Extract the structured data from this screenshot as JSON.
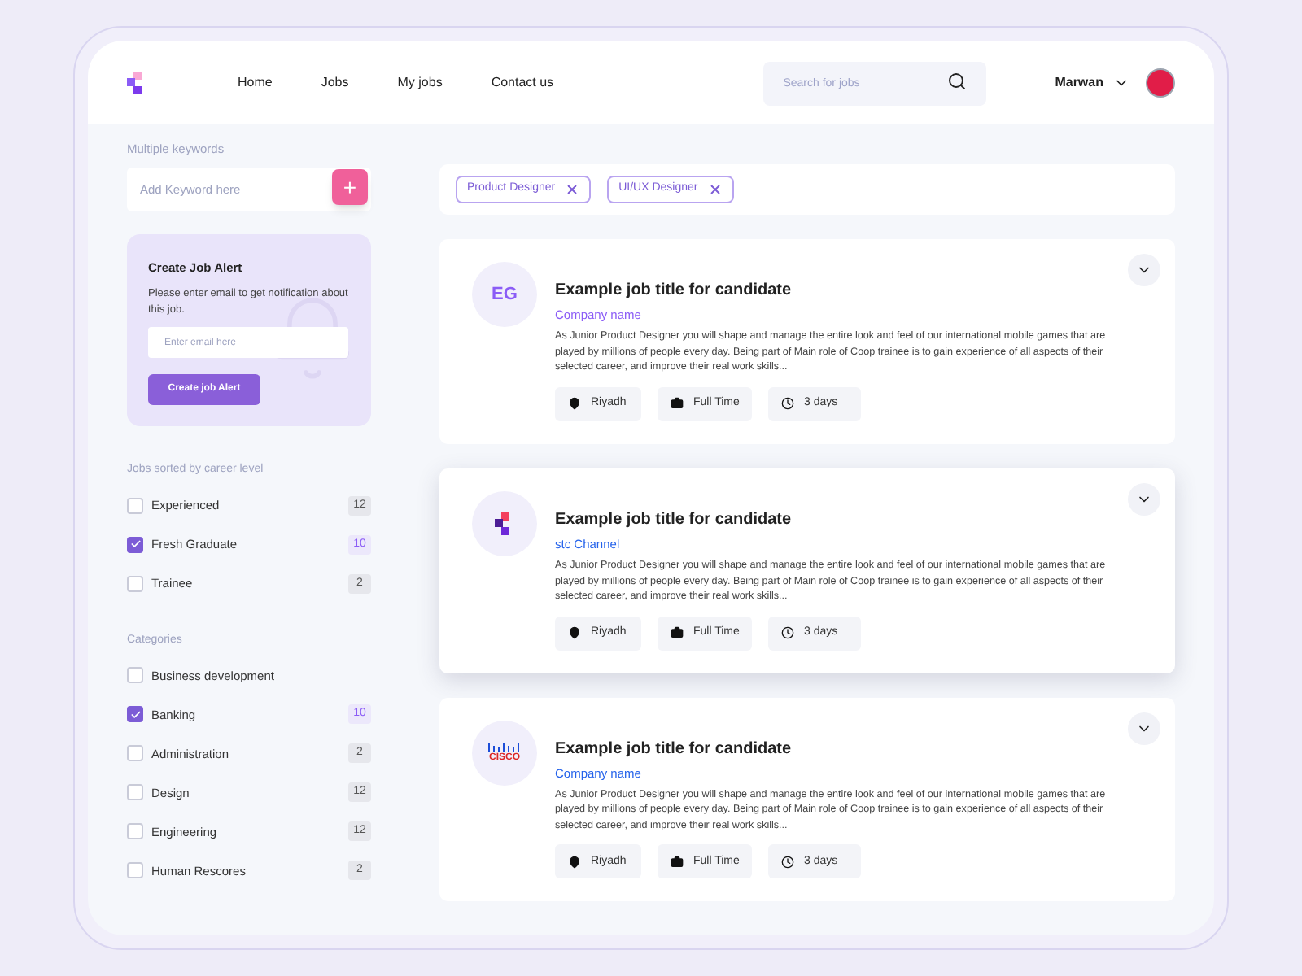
{
  "nav": {
    "links": [
      {
        "label": "Home"
      },
      {
        "label": "Jobs"
      },
      {
        "label": "My jobs"
      },
      {
        "label": "Contact us"
      }
    ],
    "search": {
      "placeholder": "Search for jobs"
    },
    "user": {
      "name": "Marwan"
    }
  },
  "sidebar": {
    "keywords": {
      "title": "Multiple keywords",
      "placeholder": "Add Keyword here",
      "add": "+"
    },
    "alert": {
      "title": "Create Job Alert",
      "text": "Please enter email to get notification about this job.",
      "placeholder": "Enter email here",
      "button": "Create job Alert"
    },
    "career": {
      "title": "Jobs sorted by career level",
      "items": [
        {
          "label": "Experienced",
          "count": "12",
          "checked": false
        },
        {
          "label": "Fresh Graduate",
          "count": "10",
          "checked": true
        },
        {
          "label": "Trainee",
          "count": "2",
          "checked": false
        }
      ]
    },
    "categories": {
      "title": "Categories",
      "items": [
        {
          "label": "Business development",
          "checked": false
        },
        {
          "label": "Banking",
          "count": "10",
          "checked": true
        },
        {
          "label": "Administration",
          "count": "2",
          "checked": false
        },
        {
          "label": "Design",
          "count": "12",
          "checked": false
        },
        {
          "label": "Engineering",
          "count": "12",
          "checked": false
        },
        {
          "label": "Human Rescores",
          "count": "2",
          "checked": false
        }
      ]
    }
  },
  "tags": [
    {
      "label": "Product Designer"
    },
    {
      "label": "UI/UX Designer"
    }
  ],
  "jobs": [
    {
      "logo": {
        "kind": "initials",
        "text": "EG"
      },
      "title": "Example job title for candidate",
      "company": "Company name",
      "color": "#8b5cf6",
      "selected": false,
      "description": "As Junior Product Designer you will shape and manage the entire look and feel of our international mobile games that are played by millions of people every day. Being part of Main role of Coop trainee is to gain experience of all aspects of their selected career, and improve their real work skills...",
      "location": "Riyadh",
      "type": "Full Time",
      "age": "3 days"
    },
    {
      "logo": {
        "kind": "mark"
      },
      "title": "Example job title for candidate",
      "company": "stc Channel",
      "color": "#2563eb",
      "selected": true,
      "description": "As Junior Product Designer you will shape and manage the entire look and feel of our international mobile games that are played by millions of people every day. Being part of Main role of Coop trainee is to gain experience of all aspects of their selected career, and improve their real work skills...",
      "location": "Riyadh",
      "type": "Full Time",
      "age": "3 days"
    },
    {
      "logo": {
        "kind": "wordmark",
        "text": "CISCO"
      },
      "title": "Example job title for candidate",
      "company": "Company name",
      "color": "#2563eb",
      "selected": false,
      "description": "As Junior Product Designer you will shape and manage the entire look and feel of our international mobile games that are played by millions of people every day. Being part of Main role of Coop trainee is to gain experience of all aspects of their selected career, and improve their real work skills...",
      "location": "Riyadh",
      "type": "Full Time",
      "age": "3 days"
    }
  ]
}
